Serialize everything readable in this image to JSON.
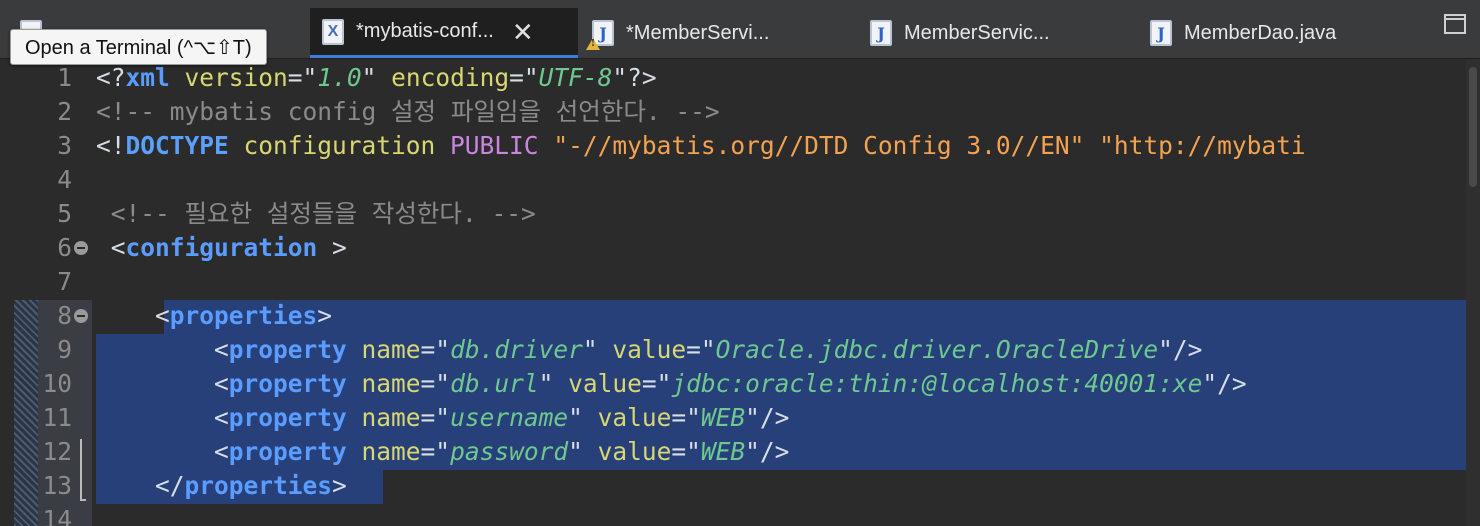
{
  "tooltip": "Open a Terminal (^⌥⇧T)",
  "tabs": [
    {
      "label": "*mybatis-conf...",
      "icon": "xml-file-icon",
      "active": true
    },
    {
      "label": "*MemberServi...",
      "icon": "java-file-icon",
      "warning": true
    },
    {
      "label": "MemberServic...",
      "icon": "java-file-icon"
    },
    {
      "label": "MemberDao.java",
      "icon": "java-file-icon"
    }
  ],
  "tab_close_glyph": "✕",
  "colors": {
    "selection": "#27407a",
    "tag": "#5a9cff",
    "attr": "#d8d770",
    "value": "#6ec98e",
    "string": "#f3a24f",
    "comment": "#8a8a8a"
  },
  "lines": [
    {
      "n": "1",
      "tokens": [
        [
          "<?",
          "p"
        ],
        [
          "xml",
          "tag"
        ],
        [
          " version",
          "attr"
        ],
        [
          "=\"",
          "eq"
        ],
        [
          "1.0",
          "val"
        ],
        [
          "\"",
          "eq"
        ],
        [
          " encoding",
          "attr"
        ],
        [
          "=\"",
          "eq"
        ],
        [
          "UTF-8",
          "val"
        ],
        [
          "\"",
          "eq"
        ],
        [
          "?>",
          "p"
        ]
      ]
    },
    {
      "n": "2",
      "tokens": [
        [
          "<!-- mybatis config 설정 파일임을 선언한다. -->",
          "comment"
        ]
      ]
    },
    {
      "n": "3",
      "tokens": [
        [
          "<!",
          "p"
        ],
        [
          "DOCTYPE",
          "doctype"
        ],
        [
          " configuration ",
          "attr"
        ],
        [
          "PUBLIC",
          "kw"
        ],
        [
          " \"-//mybatis.org//DTD Config 3.0//EN\"",
          "str"
        ],
        [
          " \"http://mybati",
          "str"
        ]
      ]
    },
    {
      "n": "4",
      "tokens": []
    },
    {
      "n": "5",
      "tokens": [
        [
          " <!-- 필요한 설정들을 작성한다. -->",
          "comment"
        ]
      ]
    },
    {
      "n": "6",
      "fold": true,
      "tokens": [
        [
          " <",
          "p"
        ],
        [
          "configuration",
          "tag"
        ],
        [
          " >",
          "p"
        ]
      ]
    },
    {
      "n": "7",
      "tokens": []
    },
    {
      "n": "8",
      "fold": true,
      "tokens": [
        [
          "    <",
          "p"
        ],
        [
          "properties",
          "tag"
        ],
        [
          ">",
          "p"
        ]
      ]
    },
    {
      "n": "9",
      "tokens": [
        [
          "        <",
          "p"
        ],
        [
          "property",
          "tag"
        ],
        [
          " name",
          "attr"
        ],
        [
          "=\"",
          "eq"
        ],
        [
          "db.driver",
          "val"
        ],
        [
          "\"",
          "eq"
        ],
        [
          " value",
          "attr"
        ],
        [
          "=\"",
          "eq"
        ],
        [
          "Oracle.jdbc.driver.OracleDrive",
          "val"
        ],
        [
          "\"",
          "eq"
        ],
        [
          "/>",
          "p"
        ]
      ]
    },
    {
      "n": "10",
      "tokens": [
        [
          "        <",
          "p"
        ],
        [
          "property",
          "tag"
        ],
        [
          " name",
          "attr"
        ],
        [
          "=\"",
          "eq"
        ],
        [
          "db.url",
          "val"
        ],
        [
          "\"",
          "eq"
        ],
        [
          " value",
          "attr"
        ],
        [
          "=\"",
          "eq"
        ],
        [
          "jdbc:oracle:thin:@localhost:40001:xe",
          "val"
        ],
        [
          "\"",
          "eq"
        ],
        [
          "/>",
          "p"
        ]
      ]
    },
    {
      "n": "11",
      "tokens": [
        [
          "        <",
          "p"
        ],
        [
          "property",
          "tag"
        ],
        [
          " name",
          "attr"
        ],
        [
          "=\"",
          "eq"
        ],
        [
          "username",
          "val"
        ],
        [
          "\"",
          "eq"
        ],
        [
          " value",
          "attr"
        ],
        [
          "=\"",
          "eq"
        ],
        [
          "WEB",
          "val"
        ],
        [
          "\"",
          "eq"
        ],
        [
          "/>",
          "p"
        ]
      ]
    },
    {
      "n": "12",
      "tokens": [
        [
          "        <",
          "p"
        ],
        [
          "property",
          "tag"
        ],
        [
          " name",
          "attr"
        ],
        [
          "=\"",
          "eq"
        ],
        [
          "password",
          "val"
        ],
        [
          "\"",
          "eq"
        ],
        [
          " value",
          "attr"
        ],
        [
          "=\"",
          "eq"
        ],
        [
          "WEB",
          "val"
        ],
        [
          "\"",
          "eq"
        ],
        [
          "/>",
          "p"
        ]
      ]
    },
    {
      "n": "13",
      "tokens": [
        [
          "    </",
          "p"
        ],
        [
          "properties",
          "tag"
        ],
        [
          ">",
          "p"
        ]
      ]
    },
    {
      "n": "14",
      "tokens": []
    }
  ]
}
